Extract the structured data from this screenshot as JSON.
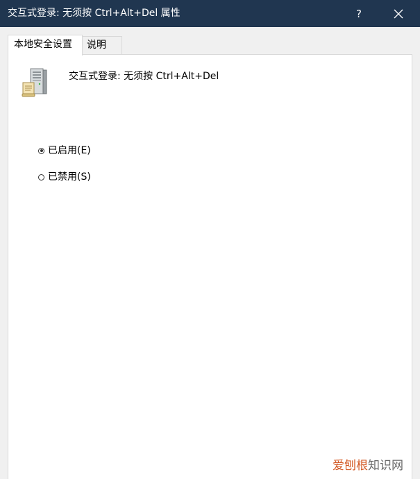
{
  "window": {
    "title": "交互式登录: 无须按 Ctrl+Alt+Del 属性",
    "help_label": "?",
    "titlebar_color": "#203650"
  },
  "tabs": [
    {
      "label": "本地安全设置",
      "active": true
    },
    {
      "label": "说明",
      "active": false
    }
  ],
  "policy": {
    "name": "交互式登录: 无须按 Ctrl+Alt+Del",
    "icon": "server-policy-icon"
  },
  "options": [
    {
      "label": "已启用(E)",
      "checked": true
    },
    {
      "label": "已禁用(S)",
      "checked": false
    }
  ],
  "watermark": {
    "part1": "爱刨根",
    "part2": "知识网"
  }
}
